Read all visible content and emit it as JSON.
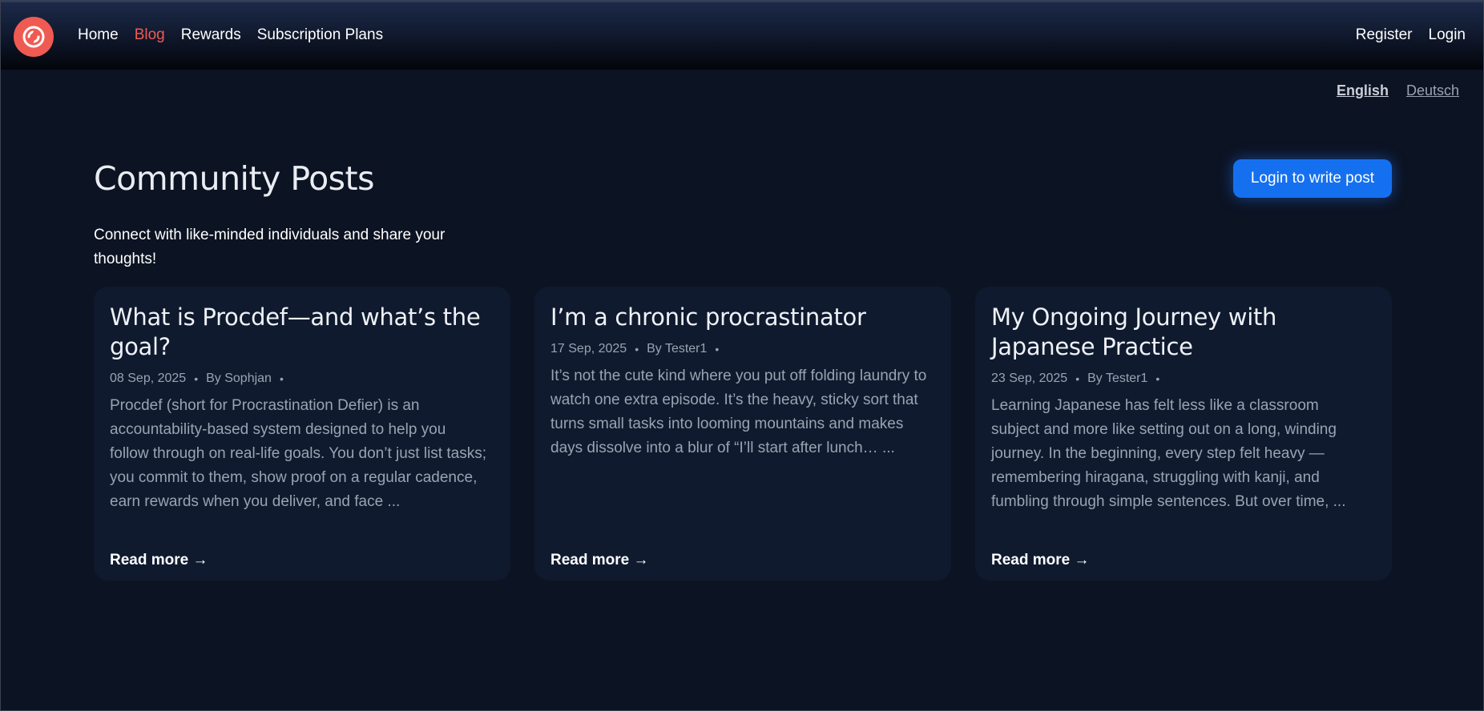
{
  "nav": {
    "links": [
      {
        "label": "Home"
      },
      {
        "label": "Blog"
      },
      {
        "label": "Rewards"
      },
      {
        "label": "Subscription Plans"
      }
    ],
    "active": "Blog",
    "register_label": "Register",
    "login_label": "Login"
  },
  "languages": {
    "english": "English",
    "deutsch": "Deutsch",
    "selected": "English"
  },
  "page": {
    "title": "Community Posts",
    "subtitle": "Connect with like-minded individuals and share your thoughts!",
    "write_button_label": "Login to write post"
  },
  "posts": [
    {
      "title": "What is Procdef—and what’s the goal?",
      "date": "08 Sep, 2025",
      "author": "By Sophjan",
      "excerpt": "Procdef (short for Procrastination Defier) is an accountability-based system designed to help you follow through on real-life goals. You don’t just list tasks; you commit to them, show proof on a regular cadence, earn rewards when you deliver, and face ...",
      "read_more": "Read more →"
    },
    {
      "title": "I’m a chronic procrastinator",
      "date": "17 Sep, 2025",
      "author": "By Tester1",
      "excerpt": "It’s not the cute kind where you put off folding laundry to watch one extra episode. It’s the heavy, sticky sort that turns small tasks into looming mountains and makes days dissolve into a blur of “I’ll start after lunch… ...",
      "read_more": "Read more →"
    },
    {
      "title": "My Ongoing Journey with Japanese Practice",
      "date": "23 Sep, 2025",
      "author": "By Tester1",
      "excerpt": "Learning Japanese has felt less like a classroom subject and more like setting out on a long, winding journey. In the beginning, every step felt heavy — remembering hiragana, struggling with kanji, and fumbling through simple sentences. But over time, ...",
      "read_more": "Read more →"
    }
  ],
  "colors": {
    "accent": "#ef5b52",
    "primary_button": "#1570f0",
    "background": "#0c1322",
    "card": "#101a2e"
  },
  "icons": {
    "logo": "procdef-logo-icon"
  }
}
